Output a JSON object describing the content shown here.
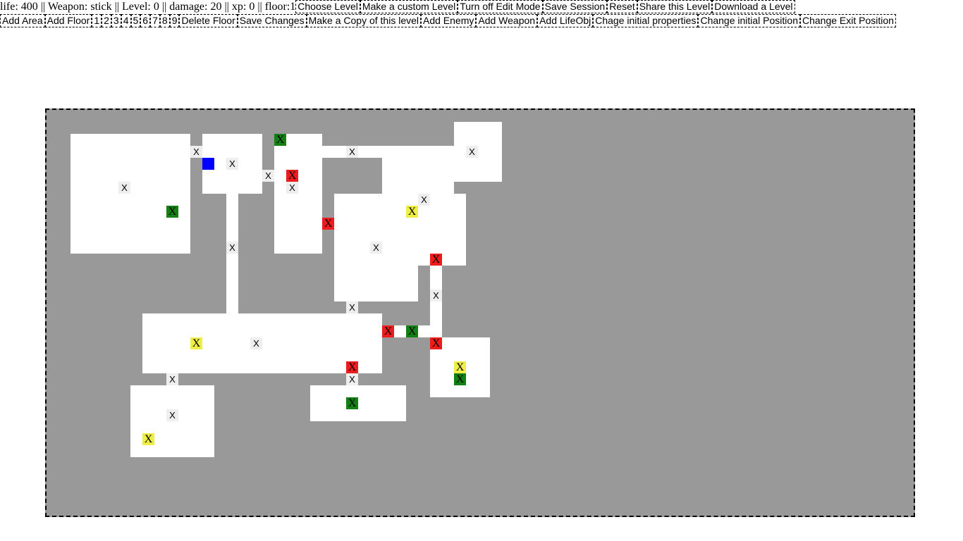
{
  "status": {
    "life_label": "life:",
    "life": "400",
    "weapon_label": "Weapon:",
    "weapon": "stick",
    "level_label": "Level:",
    "level": "0",
    "damage_label": "damage:",
    "damage": "20",
    "xp_label": "xp:",
    "xp": "0",
    "floor_label": "floor:",
    "floor": "1",
    "separator": "||"
  },
  "toolbar_top": [
    "Choose Level",
    "Make a custom Level",
    "Turn off Edit Mode",
    "Save Session",
    "Reset",
    "Share this Level",
    "Download a Level"
  ],
  "toolbar_edit": {
    "add_area": "Add Area",
    "add_floor": "Add Floor",
    "floors": [
      "1",
      "2",
      "3",
      "4",
      "5",
      "6",
      "7",
      "8",
      "9"
    ],
    "delete_floor": "Delete Floor",
    "save_changes": "Save Changes",
    "make_copy": "Make a Copy of this level",
    "add_enemy": "Add Enemy",
    "add_weapon": "Add Weapon",
    "add_lifeobj": "Add LifeObj",
    "change_props": "Chage initial properties",
    "change_position": "Change initial Position",
    "change_exit": "Change Exit Position"
  },
  "marker_text": "X",
  "colors": {
    "floor": "#999999",
    "area": "#ffffff",
    "door": "#eeeeee",
    "enemy": "#ee1c1c",
    "life": "#128012",
    "weapon": "#eeee44",
    "player": "#0000ff"
  }
}
